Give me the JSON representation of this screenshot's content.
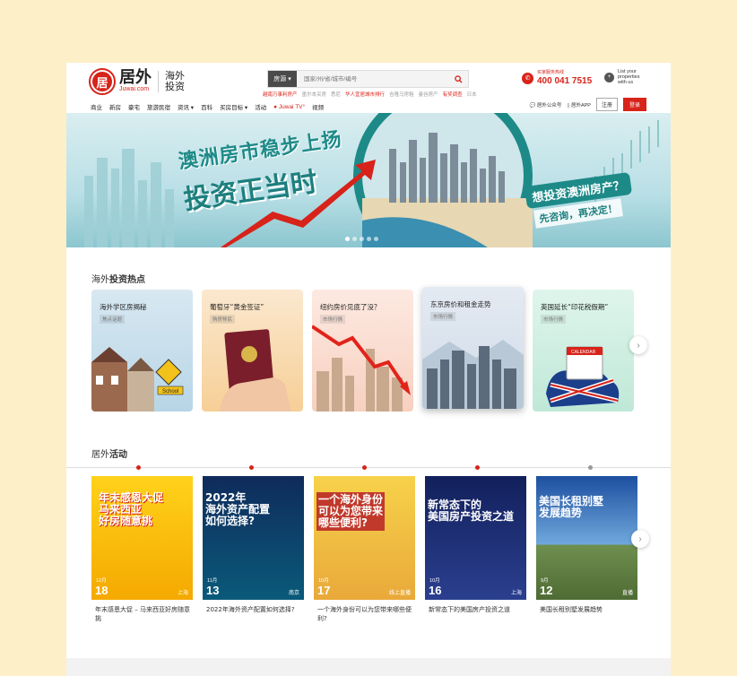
{
  "logo": {
    "cn": "居外",
    "en": "Juwai.com",
    "sub": "海外投资",
    "mark": "居"
  },
  "search": {
    "select_label": "房源 ▾",
    "placeholder": "国家/州/省/城市/编号",
    "icon": "search-icon",
    "hotwords": [
      "越南万事利房产",
      "墨尔本买房",
      "悉尼",
      "华人宜居城市排行",
      "吉隆马房租",
      "曼谷房产",
      "有奖调查",
      "日本"
    ]
  },
  "hotline": {
    "label": "买家服务热线",
    "number": "400 041 7515"
  },
  "list_property": "List your properties with us",
  "nav": {
    "items": [
      "商业",
      "新房",
      "豪宅",
      "旅游民宿",
      "资讯 ▾",
      "百科",
      "买房目标 ▾",
      "活动",
      "● Juwai TV°",
      "视频"
    ]
  },
  "util": {
    "wechat": "居外公众号",
    "app": "居外APP",
    "register": "注册",
    "login": "登录"
  },
  "banner": {
    "title_1": "澳洲房市稳步上扬",
    "title_2": "投资正当时",
    "question": "想投资澳洲房产？",
    "subline": "先咨询，再决定！",
    "slides": 5,
    "active_slide": 0
  },
  "hot_section": {
    "title_prefix": "海外",
    "title_bold": "投资热点",
    "cards": [
      {
        "title": "海外学区房揭秘",
        "tag": "焦点话题",
        "bg": "#cfe3ef"
      },
      {
        "title": "葡萄牙“黄金签证”",
        "tag": "购房移民",
        "bg": "#fbe3c2"
      },
      {
        "title": "纽约房价见底了没？",
        "tag": "市场行情",
        "bg": "#fbe0d6"
      },
      {
        "title": "东京房价和租金走势",
        "tag": "市场行情",
        "bg": "#dfe7f0"
      },
      {
        "title": "英国延长“印花税假期”",
        "tag": "市场行情",
        "bg": "#d7f0e6"
      }
    ],
    "next_label": "›"
  },
  "activity_section": {
    "title_prefix": "居外",
    "title_bold": "活动",
    "next_label": "›",
    "items": [
      {
        "headline": "年末感恩大促\n马来西亚\n好房随意挑",
        "month": "12月",
        "day": "18",
        "city": "上海",
        "caption": "年末感恩大促 – 马来西亚好房随意挑"
      },
      {
        "headline": "2022年\n海外资产配置\n如何选择?",
        "month": "11月",
        "day": "13",
        "city": "南京",
        "caption": "2022年海外资产配置如何选择?"
      },
      {
        "headline": "一个海外身份\n可以为您带来\n哪些便利?",
        "month": "10月",
        "day": "17",
        "city": "线上直播",
        "caption": "一个海外身份可以为您带来哪些便利?"
      },
      {
        "headline": "新常态下的\n美国房产投资之道",
        "month": "10月",
        "day": "16",
        "city": "上海",
        "caption": "新常态下的美国房产投资之道"
      },
      {
        "headline": "美国长租别墅\n发展趋势",
        "month": "9月",
        "day": "12",
        "city": "直播",
        "caption": "美国长租别墅发展趋势"
      }
    ]
  },
  "colors": {
    "brand_red": "#d7231a",
    "page_bg": "#fdf0c8",
    "teal": "#1d8a88"
  }
}
